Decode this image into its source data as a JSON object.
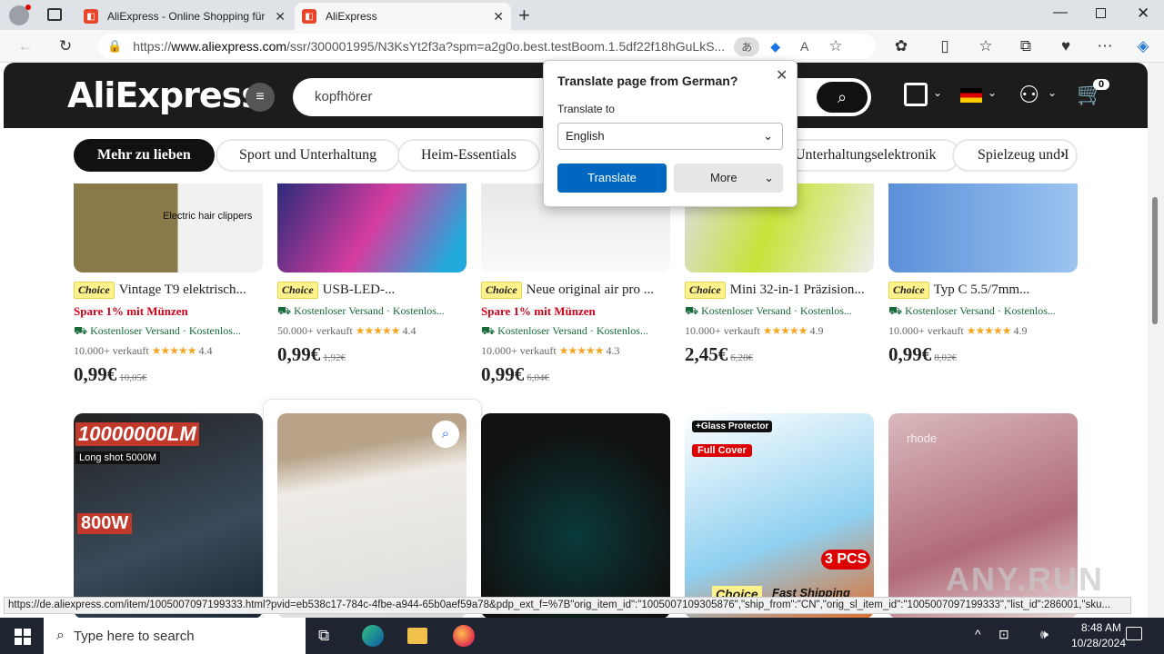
{
  "browser": {
    "tabs": [
      {
        "title": "AliExpress - Online Shopping für"
      },
      {
        "title": "AliExpress"
      }
    ],
    "url_prefix": "https://",
    "url_host": "www.aliexpress.com",
    "url_path": "/ssr/300001995/N3KsYt2f3a?spm=a2g0o.best.testBoom.1.5df22f18hGuLkS...",
    "status_url": "https://de.aliexpress.com/item/1005007097199333.html?pvid=eb538c17-784c-4fbe-a944-65b0aef59a78&pdp_ext_f=%7B\"orig_item_id\":\"1005007109305876\",\"ship_from\":\"CN\",\"orig_sl_item_id\":\"1005007097199333\",\"list_id\":286001,\"sku..."
  },
  "site": {
    "logo": "AliExpress",
    "search_value": "kopfhörer",
    "cart_count": "0"
  },
  "categories": [
    "Mehr zu lieben",
    "Sport und Unterhaltung",
    "Heim-Essentials",
    "Unterhaltungselektronik",
    "Spielzeug und I"
  ],
  "products": [
    {
      "badge": "Choice",
      "title": "Vintage T9 elektrisch...",
      "promo": "Spare 1% mit Münzen",
      "shipping": "Kostenloser Versand · Kostenlos...",
      "sold": "10.000+ verkauft",
      "stars": "★★★★★",
      "rating": "4.4",
      "price": "0,99€",
      "old_price": "10,05€",
      "img_text": "Electric hair clippers"
    },
    {
      "badge": "Choice",
      "title": "USB-LED-...",
      "promo": "",
      "shipping": "Kostenloser Versand · Kostenlos...",
      "sold": "50.000+ verkauft",
      "stars": "★★★★★",
      "rating": "4.4",
      "price": "0,99€",
      "old_price": "1,92€",
      "img_text": ""
    },
    {
      "badge": "Choice",
      "title": "Neue original air pro ...",
      "promo": "Spare 1% mit Münzen",
      "shipping": "Kostenloser Versand · Kostenlos...",
      "sold": "10.000+ verkauft",
      "stars": "★★★★★",
      "rating": "4.3",
      "price": "0,99€",
      "old_price": "6,04€",
      "img_text": ""
    },
    {
      "badge": "Choice",
      "title": "Mini 32-in-1 Präzision...",
      "promo": "",
      "shipping": "Kostenloser Versand · Kostenlos...",
      "sold": "10.000+ verkauft",
      "stars": "★★★★★",
      "rating": "4.9",
      "price": "2,45€",
      "old_price": "6,28€",
      "img_text": ""
    },
    {
      "badge": "Choice",
      "title": "Typ C 5.5/7mm...",
      "promo": "",
      "shipping": "Kostenloser Versand · Kostenlos...",
      "sold": "10.000+ verkauft",
      "stars": "★★★★★",
      "rating": "4.9",
      "price": "0,99€",
      "old_price": "8,02€",
      "img_text": ""
    }
  ],
  "row2": [
    {
      "big": "10000000LM",
      "sub": "Long shot 5000M",
      "watt": "800W"
    },
    {},
    {},
    {
      "t1": "+Glass Protector",
      "t2": "Full Cover",
      "t3": "3 PCS",
      "t4": "Choice",
      "t5": "Fast Shipping"
    },
    {
      "t1": "rhode"
    }
  ],
  "translate_popup": {
    "title": "Translate page from German?",
    "label": "Translate to",
    "language": "English",
    "translate_btn": "Translate",
    "more_btn": "More"
  },
  "taskbar": {
    "search_placeholder": "Type here to search",
    "time": "8:48 AM",
    "date": "10/28/2024"
  },
  "watermark": "ANY.RUN",
  "colors": {
    "accent": "#0067c0",
    "site_header": "#1c1c1c",
    "promo_red": "#d0021b",
    "ship_green": "#186a3b"
  }
}
